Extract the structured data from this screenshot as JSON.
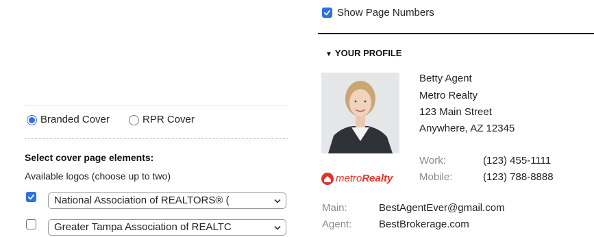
{
  "top": {
    "show_page_numbers_label": "Show Page Numbers",
    "show_page_numbers_checked": true
  },
  "profile": {
    "section_title": "YOUR PROFILE",
    "name": "Betty Agent",
    "company": "Metro Realty",
    "street": "123 Main Street",
    "city_state_zip": "Anywhere, AZ 12345",
    "work_label": "Work:",
    "work_phone": "(123) 455-1111",
    "mobile_label": "Mobile:",
    "mobile_phone": "(123) 788-8888",
    "main_label": "Main:",
    "main_value": "BestAgentEver@gmail.com",
    "agent_label": "Agent:",
    "agent_value": "BestBrokerage.com",
    "logo_text_metro": "metro",
    "logo_text_realty": "Realty",
    "colors": {
      "logo_red": "#e0332b"
    }
  },
  "cover": {
    "branded_label": "Branded Cover",
    "rpr_label": "RPR Cover",
    "selected": "Branded Cover",
    "elements_heading": "Select cover page elements:",
    "logos_hint": "Available logos (choose up to two)",
    "logos": [
      {
        "label": "National Association of REALTORS® (",
        "checked": true
      },
      {
        "label": "Greater Tampa Association of REALTC",
        "checked": false
      }
    ]
  },
  "colors": {
    "accent": "#2f6fde"
  }
}
